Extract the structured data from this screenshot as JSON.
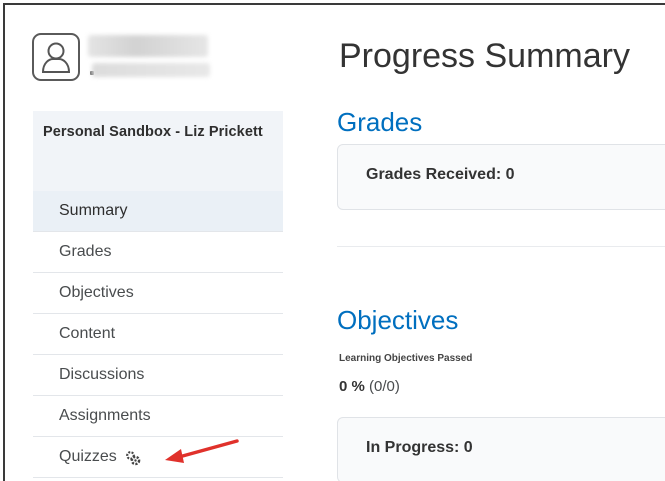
{
  "page_title": "Progress Summary",
  "sidebar": {
    "course_title": "Personal Sandbox - Liz Prickett",
    "items": [
      {
        "label": "Summary",
        "active": true
      },
      {
        "label": "Grades"
      },
      {
        "label": "Objectives"
      },
      {
        "label": "Content"
      },
      {
        "label": "Discussions"
      },
      {
        "label": "Assignments"
      },
      {
        "label": "Quizzes",
        "icon": "quiz-settings-icon"
      }
    ]
  },
  "grades": {
    "heading": "Grades",
    "received": "Grades Received: 0"
  },
  "objectives": {
    "heading": "Objectives",
    "subheading": "Learning Objectives Passed",
    "percent": "0 %",
    "fraction": "(0/0)",
    "in_progress": "In Progress: 0"
  },
  "colors": {
    "accent": "#006fbf",
    "annotation_arrow": "#e0312b",
    "active_nav_bg": "#eaf0f6"
  }
}
